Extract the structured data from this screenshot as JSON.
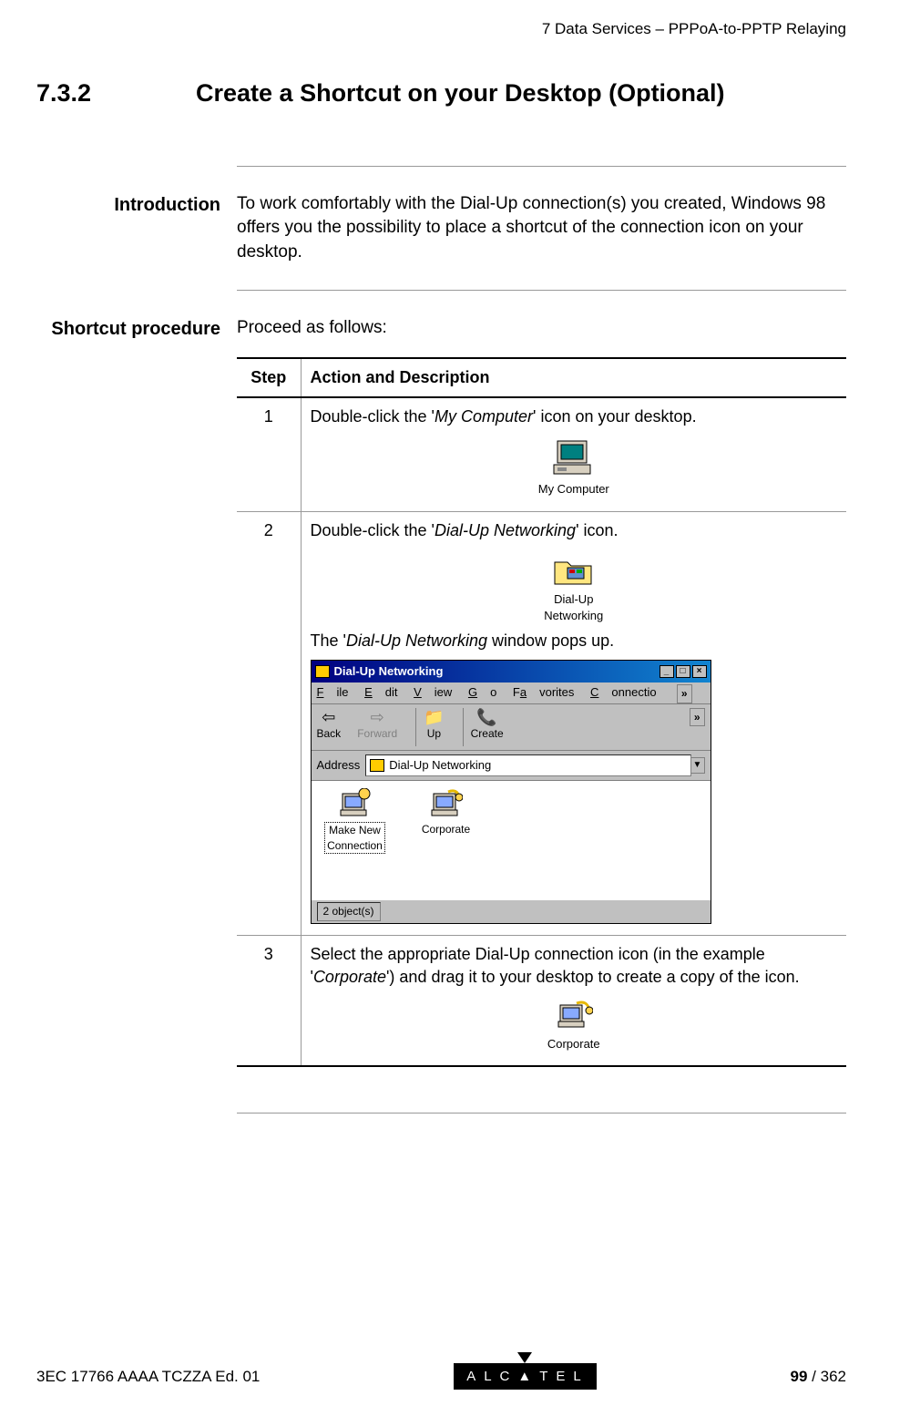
{
  "header": {
    "chapter": "7   Data Services – PPPoA-to-PPTP Relaying"
  },
  "section": {
    "number": "7.3.2",
    "title": "Create a Shortcut on your Desktop (Optional)"
  },
  "intro": {
    "label": "Introduction",
    "text": "To work comfortably with the Dial-Up connection(s) you created, Windows 98 offers you the possibility to place a shortcut of the connection icon on your desktop."
  },
  "procedure": {
    "label": "Shortcut procedure",
    "intro": "Proceed as follows:",
    "headers": {
      "step": "Step",
      "action": "Action and Description"
    },
    "steps": [
      {
        "num": "1",
        "text_a": "Double-click the '",
        "em_a": "My Computer",
        "text_b": "' icon on your desktop.",
        "icon_label": "My Computer"
      },
      {
        "num": "2",
        "text_a": "Double-click the '",
        "em_a": "Dial-Up Networking",
        "text_b": "' icon.",
        "icon_label": "Dial-Up\nNetworking",
        "after_text_a": "The '",
        "after_em": "Dial-Up Networking",
        "after_text_b": " window pops up.",
        "window": {
          "title": "Dial-Up Networking",
          "menu": {
            "file": "File",
            "edit": "Edit",
            "view": "View",
            "go": "Go",
            "fav": "Favorites",
            "conn": "Connectio",
            "more": "»"
          },
          "toolbar": {
            "back": "Back",
            "forward": "Forward",
            "up": "Up",
            "create": "Create",
            "more": "»"
          },
          "address_label": "Address",
          "address_value": "Dial-Up Networking",
          "items": [
            {
              "label": "Make New\nConnection"
            },
            {
              "label": "Corporate"
            }
          ],
          "status": "2 object(s)"
        }
      },
      {
        "num": "3",
        "text_a": "Select the appropriate Dial-Up connection icon (in the example '",
        "em_a": "Corporate",
        "text_b": "') and drag it to your desktop to  create a copy of the icon.",
        "icon_label": "Corporate"
      }
    ]
  },
  "footer": {
    "doc_id": "3EC 17766 AAAA TCZZA Ed. 01",
    "brand": "ALCATEL",
    "page": "99",
    "total": " / 362"
  }
}
